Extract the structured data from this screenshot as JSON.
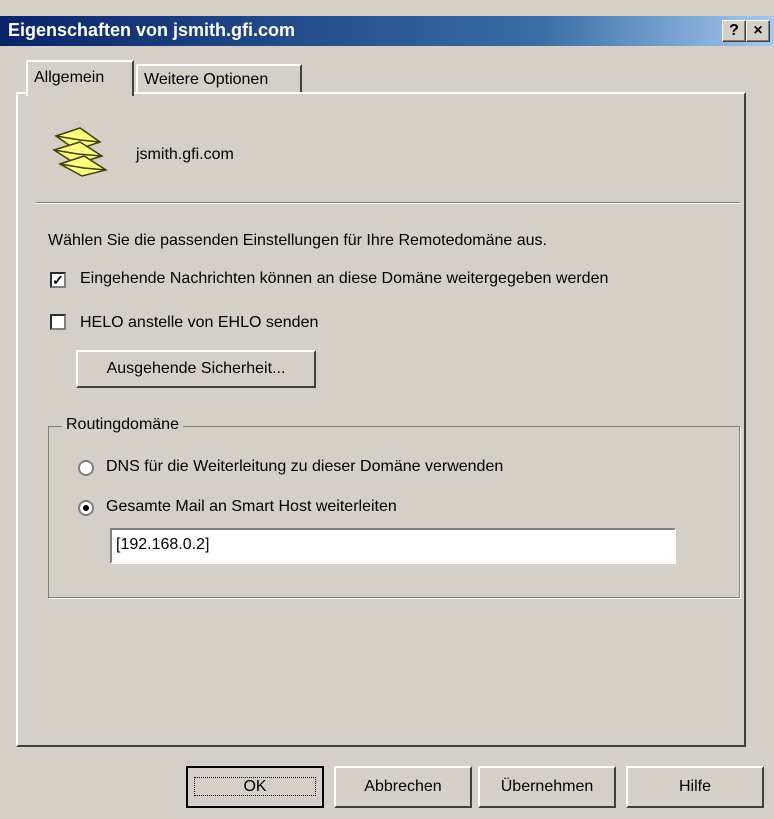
{
  "window": {
    "title": "Eigenschaften von jsmith.gfi.com",
    "help_button": "?",
    "close_button": "×"
  },
  "tabs": [
    {
      "label": "Allgemein",
      "active": true
    },
    {
      "label": "Weitere Optionen",
      "active": false
    }
  ],
  "header": {
    "domain_name": "jsmith.gfi.com",
    "icon": "envelopes-icon"
  },
  "settings": {
    "intro": "Wählen Sie die passenden Einstellungen für Ihre Remotedomäne aus.",
    "relay_checkbox": {
      "label": "Eingehende Nachrichten können an diese Domäne weitergegeben werden",
      "checked": true
    },
    "helo_checkbox": {
      "label": "HELO anstelle von EHLO senden",
      "checked": false
    },
    "outbound_security_button": "Ausgehende Sicherheit..."
  },
  "routing": {
    "group_title": "Routingdomäne",
    "dns_radio": {
      "label": "DNS für die Weiterleitung zu dieser Domäne verwenden",
      "selected": false
    },
    "smarthost_radio": {
      "label": "Gesamte Mail an Smart Host weiterleiten",
      "selected": true
    },
    "smarthost_value": "[192.168.0.2]"
  },
  "footer": {
    "ok": "OK",
    "cancel": "Abbrechen",
    "apply": "Übernehmen",
    "help": "Hilfe"
  }
}
